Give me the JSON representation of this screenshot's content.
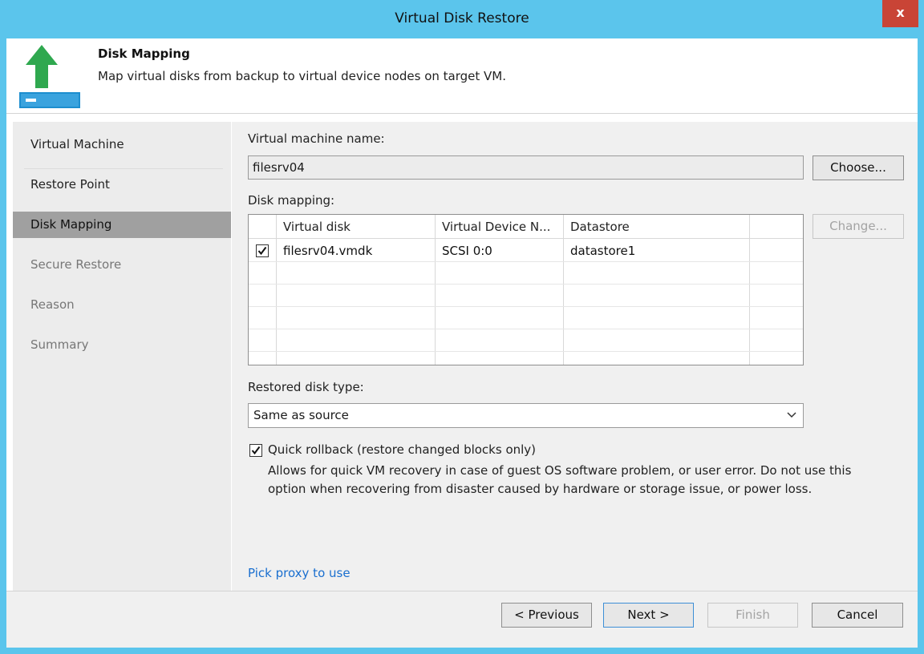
{
  "window": {
    "title": "Virtual Disk Restore",
    "close_label": "x"
  },
  "header": {
    "title": "Disk Mapping",
    "description": "Map virtual disks from backup to virtual device nodes on target VM."
  },
  "steps": [
    {
      "label": "Virtual Machine",
      "state": "completed"
    },
    {
      "label": "Restore Point",
      "state": "completed"
    },
    {
      "label": "Disk Mapping",
      "state": "active"
    },
    {
      "label": "Secure Restore",
      "state": "disabled"
    },
    {
      "label": "Reason",
      "state": "disabled"
    },
    {
      "label": "Summary",
      "state": "disabled"
    }
  ],
  "vm": {
    "label": "Virtual machine name:",
    "value": "filesrv04",
    "choose_label": "Choose..."
  },
  "mapping": {
    "label": "Disk mapping:",
    "columns": [
      "Virtual disk",
      "Virtual Device N...",
      "Datastore"
    ],
    "rows": [
      {
        "checked": true,
        "disk": "filesrv04.vmdk",
        "node": "SCSI 0:0",
        "datastore": "datastore1"
      }
    ],
    "change_label": "Change..."
  },
  "disk_type": {
    "label": "Restored disk type:",
    "value": "Same as source"
  },
  "quick_rollback": {
    "checked": true,
    "label": "Quick rollback (restore changed blocks only)",
    "description_line1": "Allows for quick VM recovery in case of guest OS software problem, or user error. Do not use this",
    "description_line2": "option when recovering from disaster caused by hardware or storage issue, or power loss."
  },
  "proxy_link": "Pick proxy to use",
  "footer": {
    "previous": "< Previous",
    "next": "Next >",
    "finish": "Finish",
    "cancel": "Cancel"
  },
  "colors": {
    "titlebar": "#5bc5ec",
    "close": "#c94436",
    "accent_green": "#2fa84f",
    "link": "#1a6fcf",
    "active_step": "#a0a0a0"
  },
  "icons": {
    "header": "green-up-arrow-disk-icon",
    "close": "close-icon",
    "dropdown": "chevron-down-icon",
    "check": "checkmark-icon"
  }
}
